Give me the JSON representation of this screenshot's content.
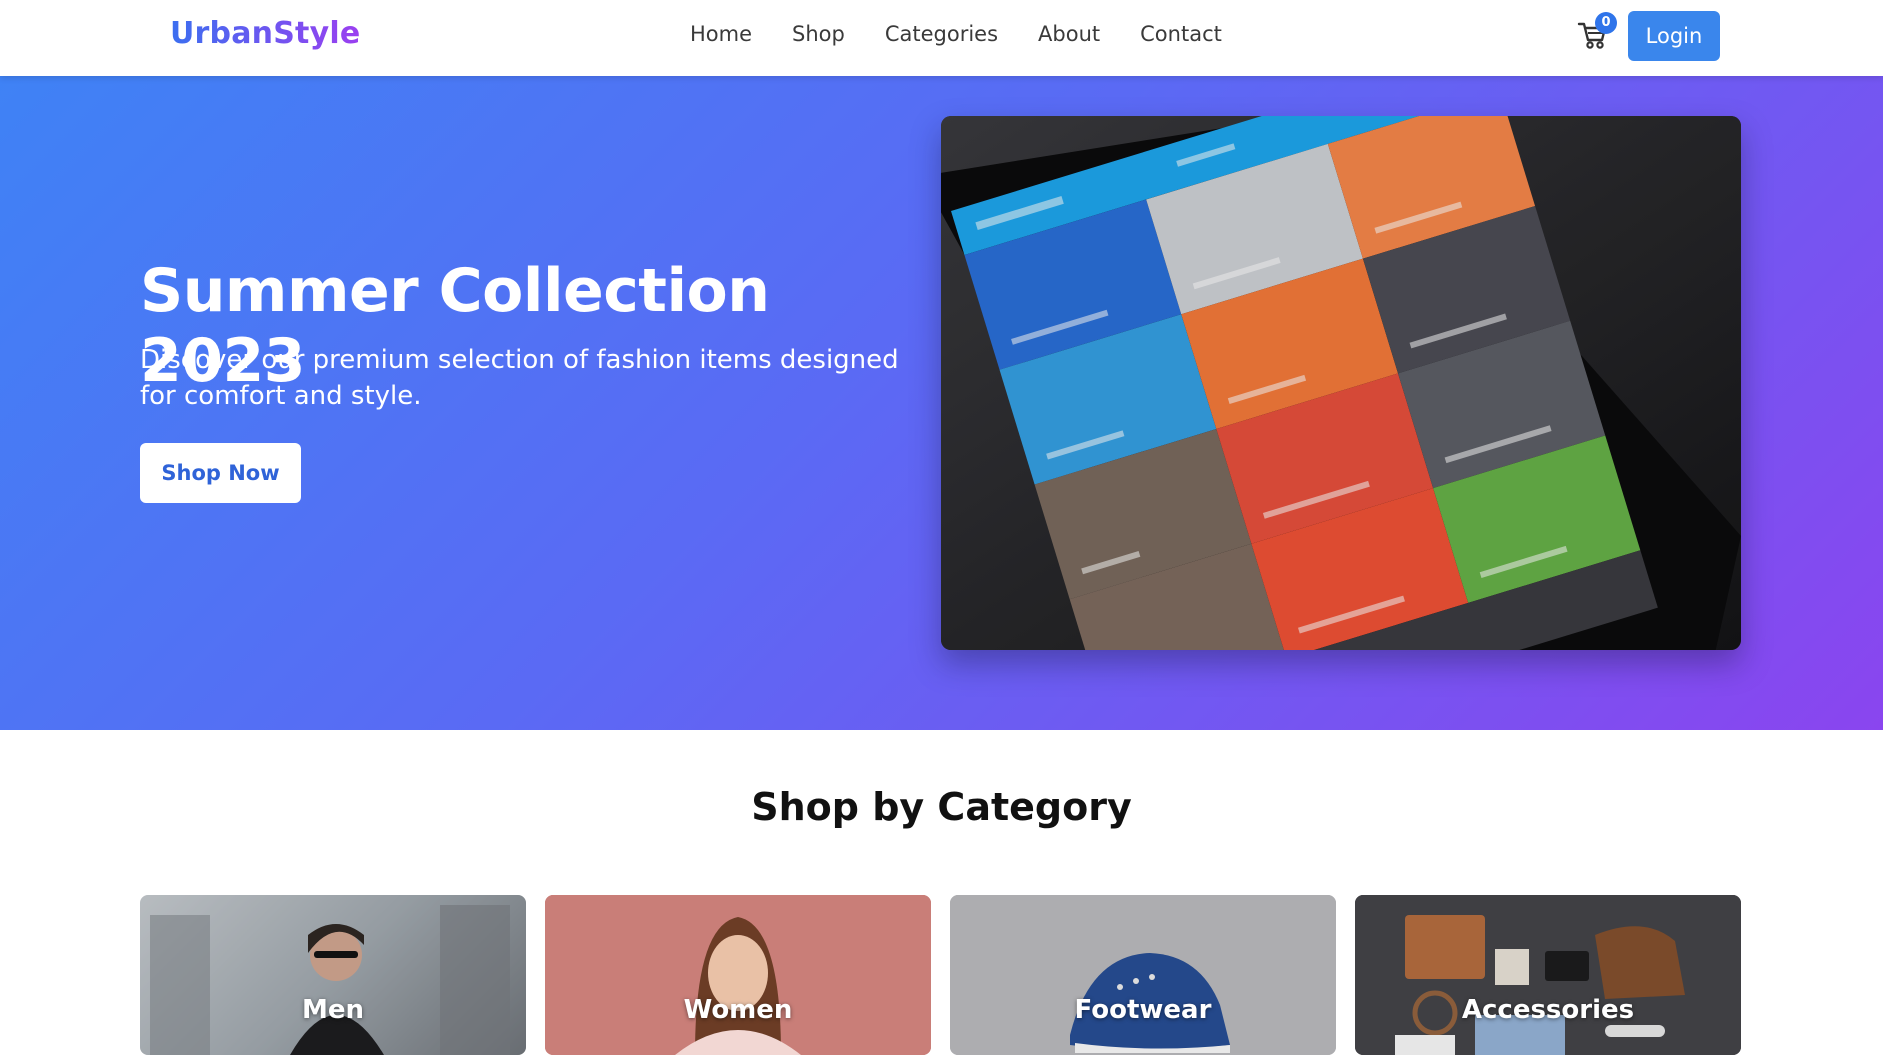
{
  "brand": {
    "name": "UrbanStyle"
  },
  "nav": {
    "links": [
      "Home",
      "Shop",
      "Categories",
      "About",
      "Contact"
    ],
    "cart_count": "0",
    "login_label": "Login"
  },
  "hero": {
    "title": "Summer Collection 2023",
    "subtitle": "Discover our premium selection of fashion items designed for comfort and style.",
    "cta_label": "Shop Now",
    "image_icon": "tablet-collections-photo"
  },
  "categories": {
    "title": "Shop by Category",
    "items": [
      {
        "label": "Men"
      },
      {
        "label": "Women"
      },
      {
        "label": "Footwear"
      },
      {
        "label": "Accessories"
      }
    ]
  },
  "colors": {
    "accent": "#3a86ec",
    "hero_start": "#3f82f5",
    "hero_end": "#8a45ef"
  }
}
